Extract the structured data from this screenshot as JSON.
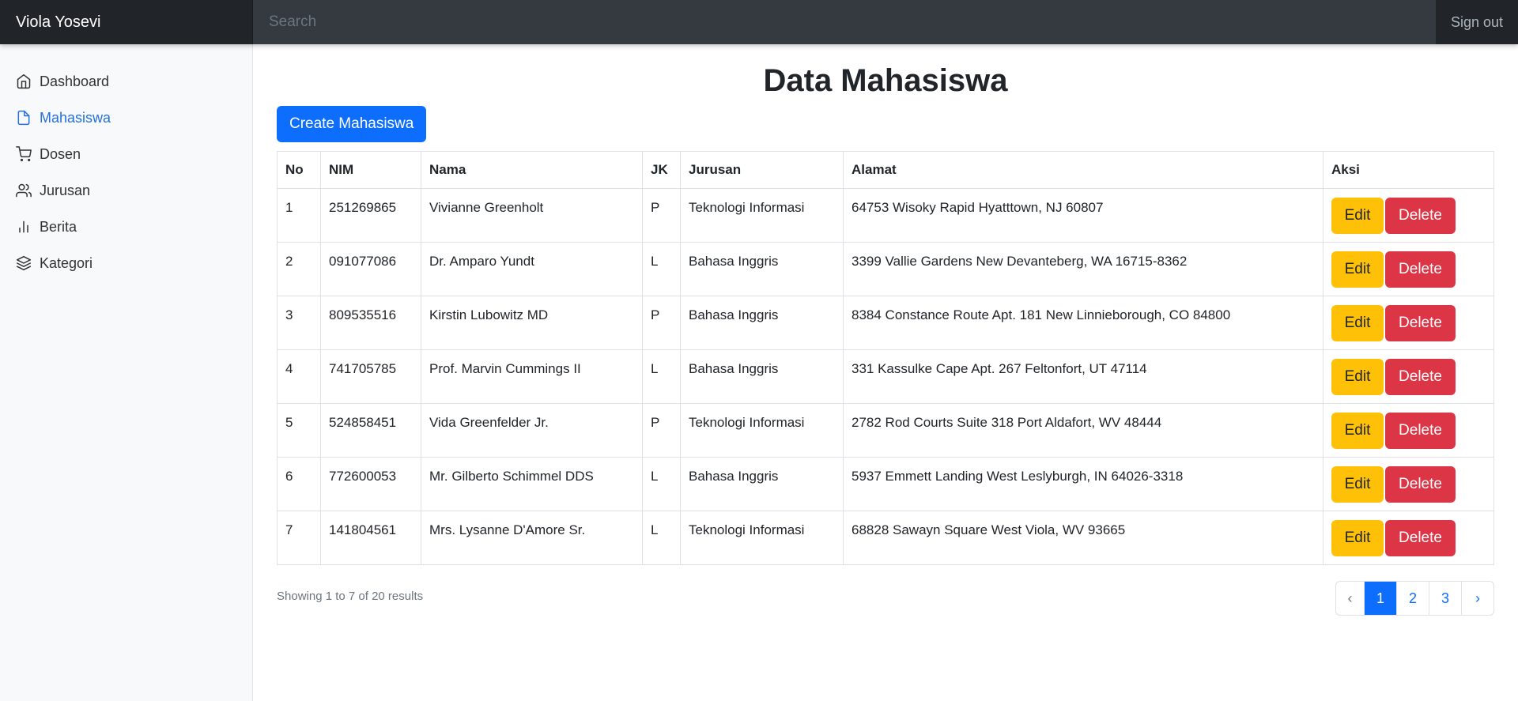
{
  "header": {
    "brand": "Viola Yosevi",
    "search_placeholder": "Search",
    "signout_label": "Sign out"
  },
  "sidebar": {
    "items": [
      {
        "label": "Dashboard",
        "icon": "home-icon",
        "active": false
      },
      {
        "label": "Mahasiswa",
        "icon": "file-icon",
        "active": true
      },
      {
        "label": "Dosen",
        "icon": "shopping-cart-icon",
        "active": false
      },
      {
        "label": "Jurusan",
        "icon": "users-icon",
        "active": false
      },
      {
        "label": "Berita",
        "icon": "bar-chart-icon",
        "active": false
      },
      {
        "label": "Kategori",
        "icon": "layers-icon",
        "active": false
      }
    ]
  },
  "main": {
    "title": "Data Mahasiswa",
    "create_label": "Create Mahasiswa",
    "table": {
      "headers": [
        "No",
        "NIM",
        "Nama",
        "JK",
        "Jurusan",
        "Alamat",
        "Aksi"
      ],
      "rows": [
        {
          "no": "1",
          "nim": "251269865",
          "nama": "Vivianne Greenholt",
          "jk": "P",
          "jurusan": "Teknologi Informasi",
          "alamat": "64753 Wisoky Rapid Hyatttown, NJ 60807"
        },
        {
          "no": "2",
          "nim": "091077086",
          "nama": "Dr. Amparo Yundt",
          "jk": "L",
          "jurusan": "Bahasa Inggris",
          "alamat": "3399 Vallie Gardens New Devanteberg, WA 16715-8362"
        },
        {
          "no": "3",
          "nim": "809535516",
          "nama": "Kirstin Lubowitz MD",
          "jk": "P",
          "jurusan": "Bahasa Inggris",
          "alamat": "8384 Constance Route Apt. 181 New Linnieborough, CO 84800"
        },
        {
          "no": "4",
          "nim": "741705785",
          "nama": "Prof. Marvin Cummings II",
          "jk": "L",
          "jurusan": "Bahasa Inggris",
          "alamat": "331 Kassulke Cape Apt. 267 Feltonfort, UT 47114"
        },
        {
          "no": "5",
          "nim": "524858451",
          "nama": "Vida Greenfelder Jr.",
          "jk": "P",
          "jurusan": "Teknologi Informasi",
          "alamat": "2782 Rod Courts Suite 318 Port Aldafort, WV 48444"
        },
        {
          "no": "6",
          "nim": "772600053",
          "nama": "Mr. Gilberto Schimmel DDS",
          "jk": "L",
          "jurusan": "Bahasa Inggris",
          "alamat": "5937 Emmett Landing West Leslyburgh, IN 64026-3318"
        },
        {
          "no": "7",
          "nim": "141804561",
          "nama": "Mrs. Lysanne D'Amore Sr.",
          "jk": "L",
          "jurusan": "Teknologi Informasi",
          "alamat": "68828 Sawayn Square West Viola, WV 93665"
        }
      ],
      "edit_label": "Edit",
      "delete_label": "Delete"
    },
    "results_text": "Showing 1 to 7 of 20 results",
    "pagination": {
      "prev": "‹",
      "pages": [
        "1",
        "2",
        "3"
      ],
      "current": "1",
      "next": "›"
    }
  },
  "colors": {
    "primary": "#0d6efd",
    "warning": "#ffc107",
    "danger": "#dc3545",
    "topbar": "#343a40",
    "brand_bg": "#212529",
    "active_nav": "#2470dc"
  }
}
